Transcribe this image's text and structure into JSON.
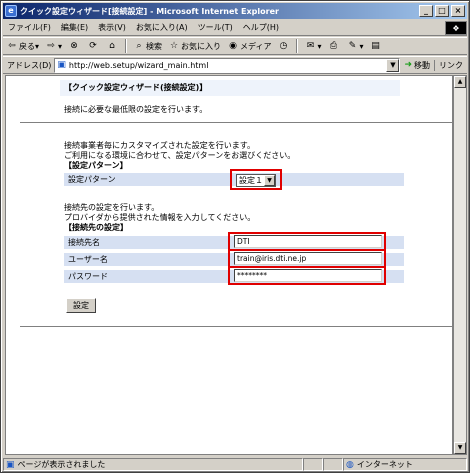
{
  "window": {
    "title": "クイック設定ウィザード[接続設定] - Microsoft Internet Explorer",
    "minimize": "_",
    "maximize": "□",
    "close": "×"
  },
  "menu": {
    "items": [
      "ファイル(F)",
      "編集(E)",
      "表示(V)",
      "お気に入り(A)",
      "ツール(T)",
      "ヘルプ(H)"
    ]
  },
  "toolbar": {
    "back": "戻る",
    "search": "検索",
    "favorites": "お気に入り",
    "media": "メディア"
  },
  "address": {
    "label": "アドレス(D)",
    "url": "http://web.setup/wizard_main.html",
    "go": "移動",
    "links": "リンク"
  },
  "page": {
    "wizard_title": "【クイック設定ウィザード(接続設定)】",
    "intro": "接続に必要な最低限の設定を行います。",
    "custom_desc_1": "接続事業者毎にカスタマイズされた設定を行います。",
    "custom_desc_2": "ご利用になる環境に合わせて、設定パターンをお選びください。",
    "pattern_section": "【設定パターン】",
    "pattern_label": "設定パターン",
    "pattern_value": "設定１",
    "dest_desc_1": "接続先の設定を行います。",
    "dest_desc_2": "プロバイダから提供された情報を入力してください。",
    "dest_section": "【接続先の設定】",
    "conn_name_label": "接続先名",
    "conn_name_value": "DTI",
    "user_label": "ユーザー名",
    "user_value": "train@iris.dti.ne.jp",
    "password_label": "パスワード",
    "password_value": "********",
    "submit": "設定"
  },
  "status": {
    "text": "ページが表示されました",
    "zone": "インターネット"
  },
  "colors": {
    "title_bar": "#0a246a",
    "highlight": "#e00000",
    "form_row": "#d6e0f2"
  }
}
